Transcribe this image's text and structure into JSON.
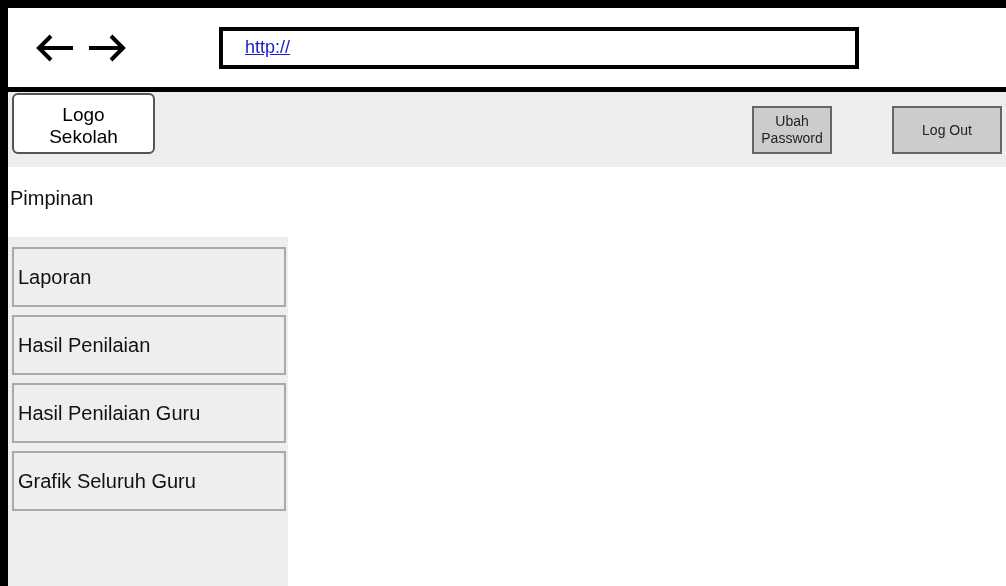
{
  "browser": {
    "address": "http://"
  },
  "header": {
    "logo": "Logo\nSekolah",
    "buttons": [
      "Ubah\nPassword",
      "Log Out"
    ]
  },
  "sidebar": {
    "title": "Pimpinan",
    "items": [
      {
        "label": "Laporan"
      },
      {
        "label": "Hasil Penilaian"
      },
      {
        "label": "Hasil Penilaian Guru"
      },
      {
        "label": "Grafik Seluruh Guru"
      }
    ]
  }
}
